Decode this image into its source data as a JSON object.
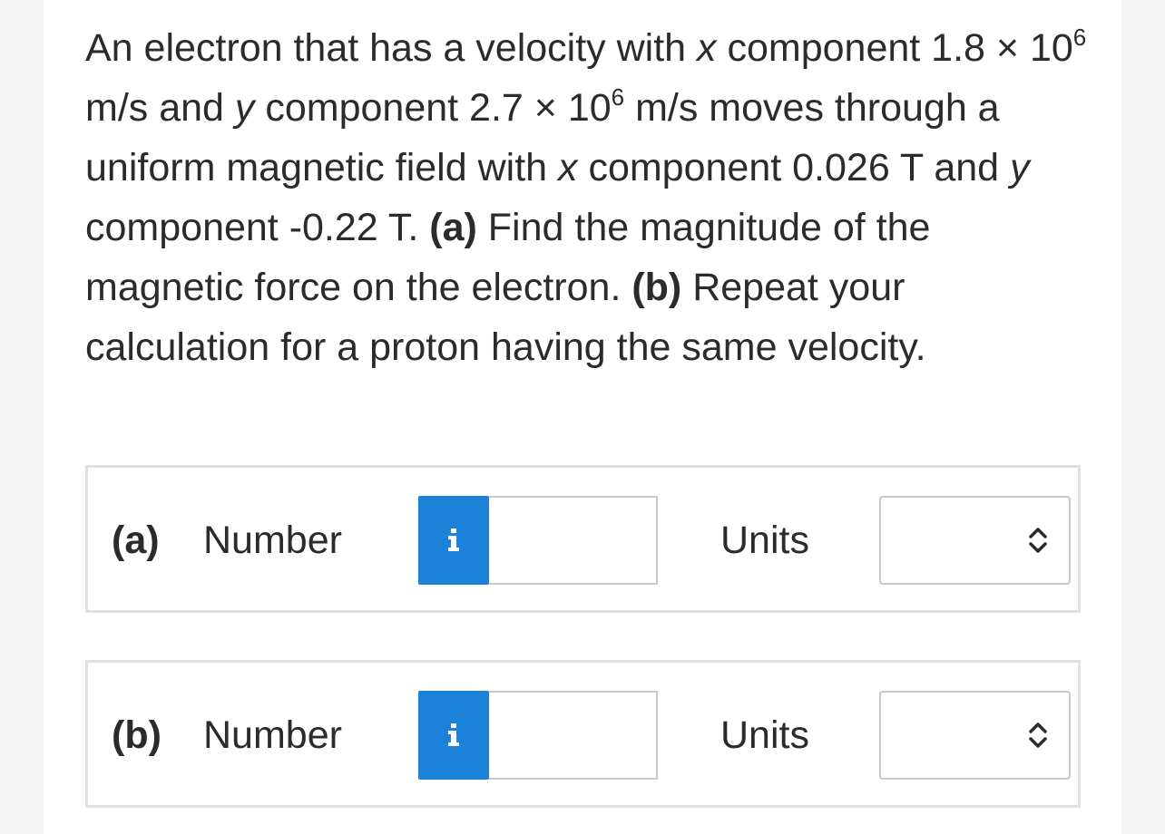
{
  "question": {
    "p1": "An electron that has a velocity with ",
    "x1": "x",
    "p2": " component 1.8 × 10",
    "exp1": "6",
    "p3": " m/s and ",
    "y1": "y",
    "p4": " component 2.7 × 10",
    "exp2": "6",
    "p5": " m/s moves through a uniform magnetic field with ",
    "x2": "x",
    "p6": " component 0.026 T and ",
    "y2": "y",
    "p7": " component -0.22 T. ",
    "part_a_marker": "(a)",
    "part_a_text": " Find the magnitude of the magnetic force on the electron. ",
    "part_b_marker": "(b)",
    "part_b_text": " Repeat your calculation for a proton having the same velocity."
  },
  "answers": [
    {
      "part": "(a)",
      "number_label": "Number",
      "number_value": "",
      "units_label": "Units",
      "units_value": "",
      "info_icon": "info-icon",
      "select_icon": "up-down-chevron-icon"
    },
    {
      "part": "(b)",
      "number_label": "Number",
      "number_value": "",
      "units_label": "Units",
      "units_value": "",
      "info_icon": "info-icon",
      "select_icon": "up-down-chevron-icon"
    }
  ],
  "colors": {
    "info_button": "#1a82d9",
    "text": "#2b2b2b",
    "box_border": "#e1e1e1"
  }
}
